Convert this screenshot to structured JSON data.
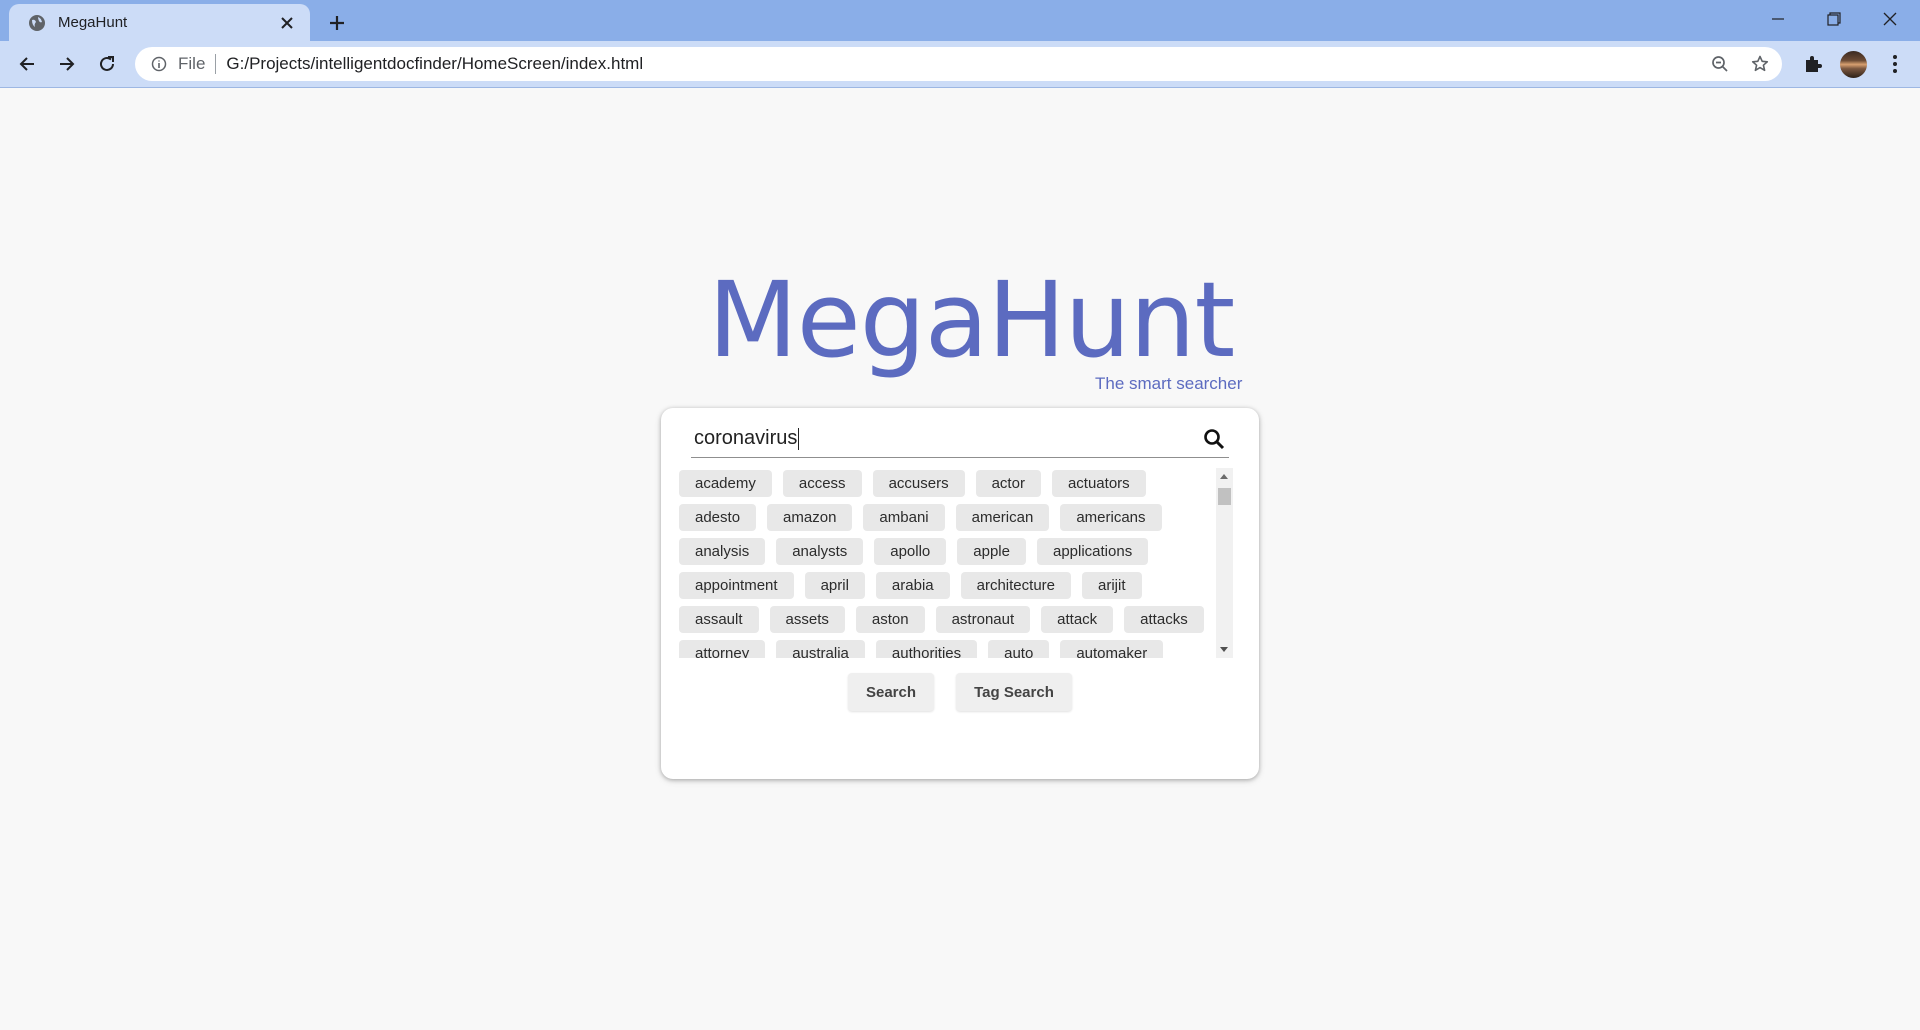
{
  "browser": {
    "tab_title": "MegaHunt",
    "omnibox_scheme": "File",
    "omnibox_url": "G:/Projects/intelligentdocfinder/HomeScreen/index.html"
  },
  "page": {
    "logo": "MegaHunt",
    "tagline": "The smart searcher",
    "search_query": "coronavirus",
    "tag_rows": [
      [
        "academy",
        "access",
        "accusers",
        "actor",
        "actuators"
      ],
      [
        "adesto",
        "amazon",
        "ambani",
        "american",
        "americans"
      ],
      [
        "analysis",
        "analysts",
        "apollo",
        "apple",
        "applications"
      ],
      [
        "appointment",
        "april",
        "arabia",
        "architecture",
        "arijit"
      ],
      [
        "assault",
        "assets",
        "aston",
        "astronaut",
        "attack",
        "attacks"
      ],
      [
        "attorney",
        "australia",
        "authorities",
        "auto",
        "automaker"
      ]
    ],
    "search_button": "Search",
    "tag_search_button": "Tag Search"
  },
  "colors": {
    "brand": "#5c6bc0",
    "tabbar": "#8aaee8",
    "toolbar": "#ccdcf7"
  }
}
